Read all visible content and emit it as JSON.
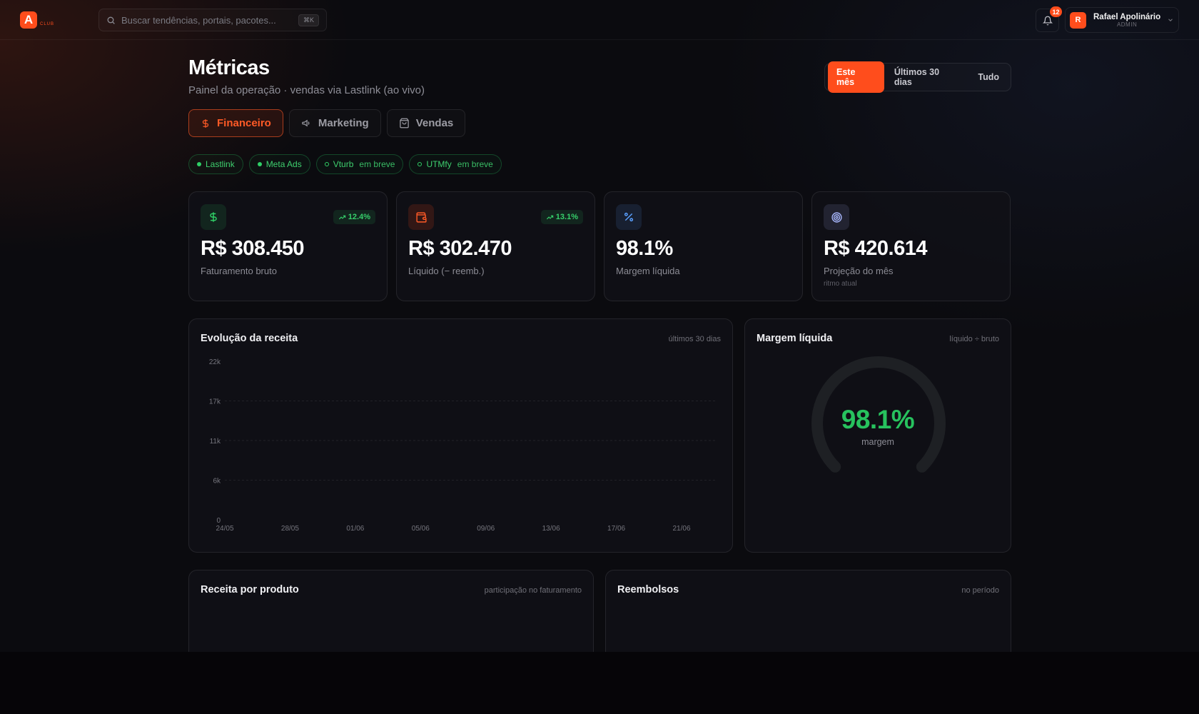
{
  "brand": {
    "logo_letter": "A",
    "logo_sub": "CLUB"
  },
  "search": {
    "placeholder": "Buscar tendências, portais, pacotes...",
    "shortcut": "⌘K"
  },
  "notifications": {
    "count": "12"
  },
  "user": {
    "initial": "R",
    "name": "Rafael Apolinário",
    "role": "ADMIN"
  },
  "header": {
    "title": "Métricas",
    "subtitle": "Painel da operação · vendas via Lastlink (ao vivo)"
  },
  "range": {
    "options": [
      "Este mês",
      "Últimos 30 dias",
      "Tudo"
    ],
    "active": "Este mês"
  },
  "tabs": [
    {
      "label": "Financeiro",
      "icon": "dollar-icon",
      "active": true
    },
    {
      "label": "Marketing",
      "icon": "megaphone-icon",
      "active": false
    },
    {
      "label": "Vendas",
      "icon": "shopping-bag-icon",
      "active": false
    }
  ],
  "integrations": [
    {
      "label": "Lastlink",
      "status": "connected",
      "note": ""
    },
    {
      "label": "Meta Ads",
      "status": "connected",
      "note": ""
    },
    {
      "label": "Vturb",
      "status": "soon",
      "note": "em breve"
    },
    {
      "label": "UTMfy",
      "status": "soon",
      "note": "em breve"
    }
  ],
  "kpis": [
    {
      "icon": "dollar-icon",
      "value": "R$ 308.450",
      "label": "Faturamento bruto",
      "trend": "12.4%",
      "note": "",
      "color": "#2fcf66"
    },
    {
      "icon": "wallet-icon",
      "value": "R$ 302.470",
      "label": "Líquido (− reemb.)",
      "trend": "13.1%",
      "note": "",
      "color": "#ff5a26"
    },
    {
      "icon": "percent-icon",
      "value": "98.1%",
      "label": "Margem líquida",
      "trend": "",
      "note": "",
      "color": "#5aa0ff"
    },
    {
      "icon": "target-icon",
      "value": "R$ 420.614",
      "label": "Projeção do mês",
      "trend": "",
      "note": "ritmo atual",
      "color": "#a9b8ff"
    }
  ],
  "revenue_panel": {
    "title": "Evolução da receita",
    "meta": "últimos 30 dias"
  },
  "margin_panel": {
    "title": "Margem líquida",
    "meta": "líquido ÷ bruto",
    "value": "98.1%",
    "label": "margem",
    "fraction": 0.981
  },
  "product_panel": {
    "title": "Receita por produto",
    "meta": "participação no faturamento"
  },
  "refund_panel": {
    "title": "Reembolsos",
    "meta": "no período"
  },
  "chart_data": {
    "type": "line",
    "title": "Evolução da receita",
    "xlabel": "",
    "ylabel": "",
    "x": [
      "24/05",
      "28/05",
      "01/06",
      "05/06",
      "09/06",
      "13/06",
      "17/06",
      "21/06"
    ],
    "y_ticks": [
      "0",
      "6k",
      "11k",
      "17k",
      "22k"
    ],
    "y_tick_values": [
      0,
      5500,
      11000,
      16500,
      22000
    ],
    "ylim": [
      0,
      22000
    ],
    "series": [],
    "grid": true
  },
  "colors": {
    "accent": "#ff4d1c",
    "positive": "#2fcf66"
  }
}
